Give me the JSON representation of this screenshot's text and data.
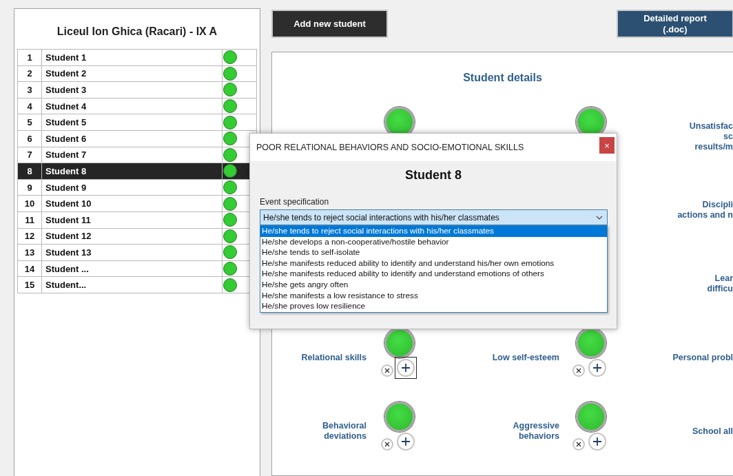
{
  "class_panel": {
    "title": "Liceul Ion Ghica (Racari) - IX A",
    "students": [
      {
        "number": "1",
        "name": "Student 1",
        "selected": false,
        "color": "#33cc33"
      },
      {
        "number": "2",
        "name": "Student 2",
        "selected": false,
        "color": "#33cc33"
      },
      {
        "number": "3",
        "name": "Student 3",
        "selected": false,
        "color": "#33cc33"
      },
      {
        "number": "4",
        "name": "Studnet 4",
        "selected": false,
        "color": "#33cc33"
      },
      {
        "number": "5",
        "name": "Student 5",
        "selected": false,
        "color": "#33cc33"
      },
      {
        "number": "6",
        "name": "Student 6",
        "selected": false,
        "color": "#33cc33"
      },
      {
        "number": "7",
        "name": "Student 7",
        "selected": false,
        "color": "#33cc33"
      },
      {
        "number": "8",
        "name": "Student 8",
        "selected": true,
        "color": "#33cc33"
      },
      {
        "number": "9",
        "name": "Student 9",
        "selected": false,
        "color": "#33cc33"
      },
      {
        "number": "10",
        "name": "Student 10",
        "selected": false,
        "color": "#33cc33"
      },
      {
        "number": "11",
        "name": "Student 11",
        "selected": false,
        "color": "#33cc33"
      },
      {
        "number": "12",
        "name": "Student 12",
        "selected": false,
        "color": "#33cc33"
      },
      {
        "number": "13",
        "name": "Student 13",
        "selected": false,
        "color": "#33cc33"
      },
      {
        "number": "14",
        "name": "Student ...",
        "selected": false,
        "color": "#33cc33"
      },
      {
        "number": "15",
        "name": "Student...",
        "selected": false,
        "color": "#33cc33"
      }
    ]
  },
  "toolbar": [
    {
      "kind": "add",
      "label": "Add new student"
    },
    {
      "kind": "report",
      "label": "Detailed report\n(.doc)"
    }
  ],
  "details": {
    "title": "Student details",
    "rows": [
      {
        "left": {
          "kind": "lamp"
        },
        "middle": {
          "kind": "lamp"
        },
        "right": {
          "label": "Unsatisfac\nsc\nresults/m"
        }
      },
      {
        "right": {
          "label": "Discipli\nactions and n"
        }
      },
      {
        "right": {
          "label": "Lear\ndifficu"
        }
      },
      {
        "left": {
          "kind": "full",
          "label": "Relational skills",
          "focused": true
        },
        "middle": {
          "kind": "full",
          "label": "Low self-esteem",
          "focused": false
        },
        "right": {
          "label": "Personal probl"
        }
      },
      {
        "left": {
          "kind": "full",
          "label": "Behavioral\ndeviations",
          "focused": false
        },
        "middle": {
          "kind": "full",
          "label": "Aggressive\nbehaviors",
          "focused": false
        },
        "right": {
          "label": "School all"
        }
      }
    ]
  },
  "dialog": {
    "title": "POOR RELATIONAL BEHAVIORS AND SOCIO-EMOTIONAL SKILLS",
    "close": "×",
    "heading": "Student 8",
    "field_label": "Event specification",
    "value": "He/she tends to reject social interactions with his/her classmates",
    "options": [
      {
        "label": "He/she tends to reject social interactions with his/her classmates",
        "selected": true
      },
      {
        "label": "He/she develops a non-cooperative/hostile behavior",
        "selected": false
      },
      {
        "label": "He/she tends to self-isolate",
        "selected": false
      },
      {
        "label": "He/she manifests reduced ability to identify and understand his/her own emotions",
        "selected": false
      },
      {
        "label": "He/she manifests reduced ability to identify and understand emotions of others",
        "selected": false
      },
      {
        "label": "He/she gets angry often",
        "selected": false
      },
      {
        "label": "He/she manifests a low resistance to stress",
        "selected": false
      },
      {
        "label": "He/she proves low resilience",
        "selected": false
      }
    ]
  }
}
